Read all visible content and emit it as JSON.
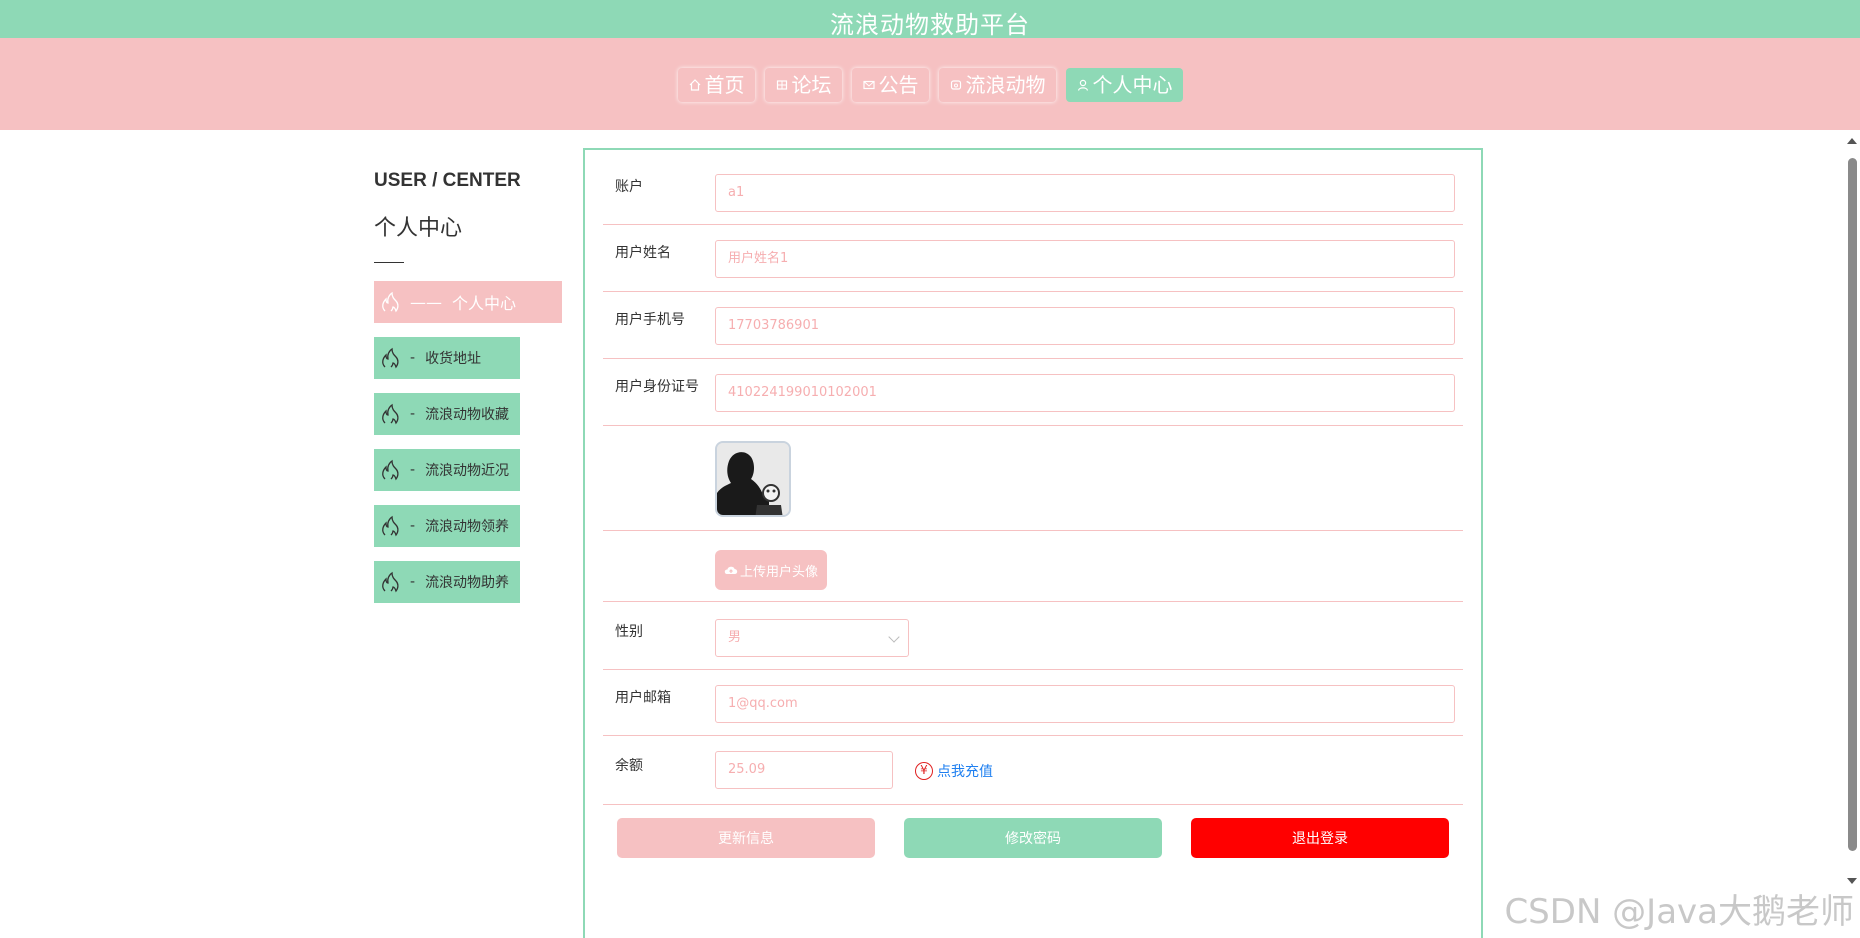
{
  "header": {
    "title": "流浪动物救助平台"
  },
  "nav": [
    {
      "label": "首页",
      "icon": "home-icon",
      "active": false
    },
    {
      "label": "论坛",
      "icon": "forum-icon",
      "active": false
    },
    {
      "label": "公告",
      "icon": "mail-icon",
      "active": false
    },
    {
      "label": "流浪动物",
      "icon": "pet-icon",
      "active": false
    },
    {
      "label": "个人中心",
      "icon": "user-icon",
      "active": true
    }
  ],
  "sidebar": {
    "title_en": "USER / CENTER",
    "title_cn": "个人中心",
    "items": [
      {
        "label": "个人中心",
        "prefix": "——",
        "active": true
      },
      {
        "label": "收货地址",
        "prefix": "-"
      },
      {
        "label": "流浪动物收藏",
        "prefix": "-"
      },
      {
        "label": "流浪动物近况",
        "prefix": "-"
      },
      {
        "label": "流浪动物领养",
        "prefix": "-"
      },
      {
        "label": "流浪动物助养",
        "prefix": "-"
      }
    ]
  },
  "form": {
    "account": {
      "label": "账户",
      "value": "a1"
    },
    "username": {
      "label": "用户姓名",
      "value": "用户姓名1"
    },
    "phone": {
      "label": "用户手机号",
      "value": "17703786901"
    },
    "idcard": {
      "label": "用户身份证号",
      "value": "410224199010102001"
    },
    "upload_label": "上传用户头像",
    "gender": {
      "label": "性别",
      "value": "男"
    },
    "email": {
      "label": "用户邮箱",
      "value": "1@qq.com"
    },
    "balance": {
      "label": "余额",
      "value": "25.09",
      "recharge_label": "点我充值"
    }
  },
  "buttons": {
    "update": "更新信息",
    "change_password": "修改密码",
    "logout": "退出登录"
  },
  "watermark": "CSDN @Java大鹅老师",
  "colors": {
    "mint": "#8ed9b6",
    "pink": "#f6c1c2",
    "logout": "#ff0000",
    "link": "#1e7ff0"
  }
}
